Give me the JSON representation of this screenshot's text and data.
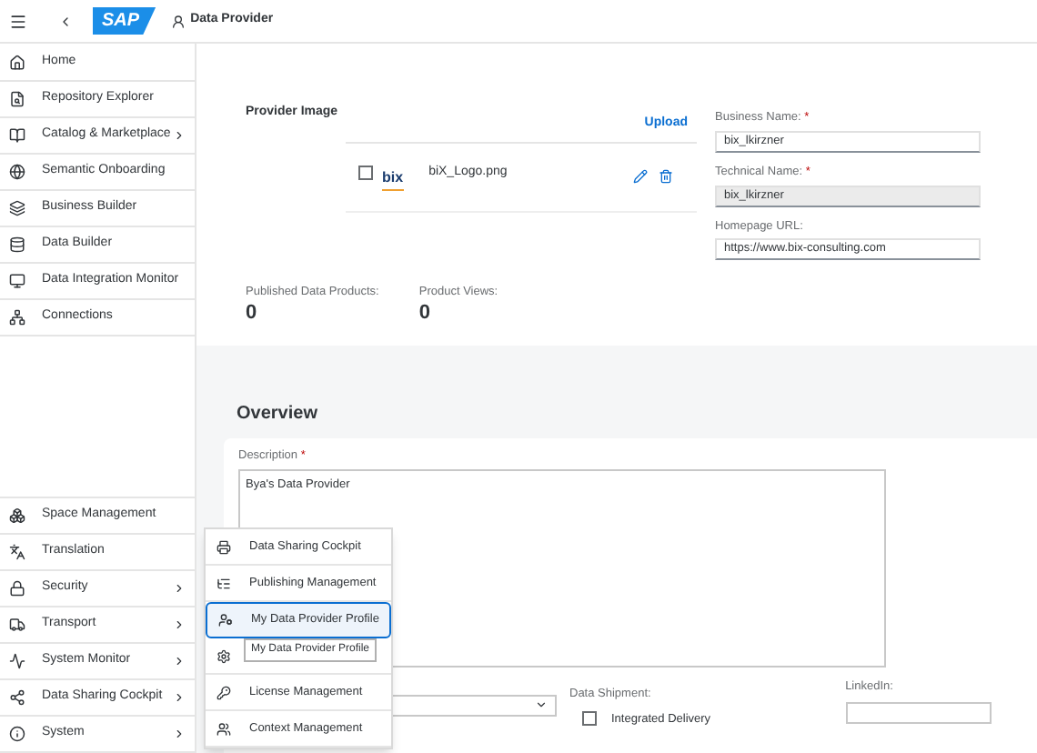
{
  "header": {
    "logo": "SAP",
    "title": "Data Provider"
  },
  "sidebar": {
    "top_items": [
      {
        "label": "Home",
        "submenu": false
      },
      {
        "label": "Repository Explorer",
        "submenu": false
      },
      {
        "label": "Catalog & Marketplace",
        "submenu": true
      },
      {
        "label": "Semantic Onboarding",
        "submenu": false
      },
      {
        "label": "Business Builder",
        "submenu": false
      },
      {
        "label": "Data Builder",
        "submenu": false
      },
      {
        "label": "Data Integration Monitor",
        "submenu": false
      },
      {
        "label": "Connections",
        "submenu": false
      }
    ],
    "bottom_items": [
      {
        "label": "Space Management",
        "submenu": false
      },
      {
        "label": "Translation",
        "submenu": false
      },
      {
        "label": "Security",
        "submenu": true
      },
      {
        "label": "Transport",
        "submenu": true
      },
      {
        "label": "System Monitor",
        "submenu": true
      },
      {
        "label": "Data Sharing Cockpit",
        "submenu": true
      },
      {
        "label": "System",
        "submenu": true
      }
    ]
  },
  "popup_menu": {
    "items": [
      {
        "label": "Data Sharing Cockpit",
        "selected": false
      },
      {
        "label": "Publishing Management",
        "selected": false
      },
      {
        "label": "My Data Provider Profile",
        "selected": true
      },
      {
        "selected": false
      },
      {
        "label": "License Management",
        "selected": false
      },
      {
        "label": "Context Management",
        "selected": false
      }
    ]
  },
  "tooltip": "My Data Provider Profile",
  "provider_image": {
    "title": "Provider Image",
    "upload": "Upload",
    "file": {
      "checked": false,
      "logo": "bix",
      "name": "biX_Logo.png"
    }
  },
  "stats": [
    {
      "label": "Published Data Products:",
      "value": "0"
    },
    {
      "label": "Product Views:",
      "value": "0"
    }
  ],
  "fields": [
    {
      "label": "Business Name:",
      "required_mark": "*",
      "value": "bix_lkirzner",
      "disabled": false
    },
    {
      "label": "Technical Name:",
      "required_mark": "*",
      "value": "bix_lkirzner",
      "disabled": true
    },
    {
      "label": "Homepage URL:",
      "value": "https://www.bix-consulting.com",
      "disabled": false
    }
  ],
  "overview": {
    "title": "Overview",
    "description_label": "Description",
    "required_mark": "*",
    "description": "Bya's Data Provider",
    "data_shipment": {
      "label": "Data Shipment:",
      "option": {
        "label": "Integrated Delivery",
        "checked": false
      }
    },
    "linkedin": {
      "label": "LinkedIn:"
    }
  }
}
